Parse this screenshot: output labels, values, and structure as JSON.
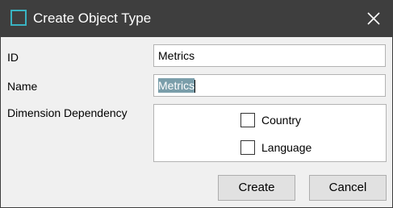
{
  "window": {
    "title": "Create Object Type",
    "app_icon": "square-outline-icon",
    "close_icon": "close-icon",
    "accent_color": "#39b3c2",
    "titlebar_color": "#3e3e3e"
  },
  "form": {
    "id_label": "ID",
    "id_value": "Metrics",
    "name_label": "Name",
    "name_value": "Metrics",
    "dependency_label": "Dimension Dependency",
    "dependencies": [
      {
        "label": "Country",
        "checked": false
      },
      {
        "label": "Language",
        "checked": false
      }
    ]
  },
  "buttons": {
    "create_label": "Create",
    "cancel_label": "Cancel"
  }
}
